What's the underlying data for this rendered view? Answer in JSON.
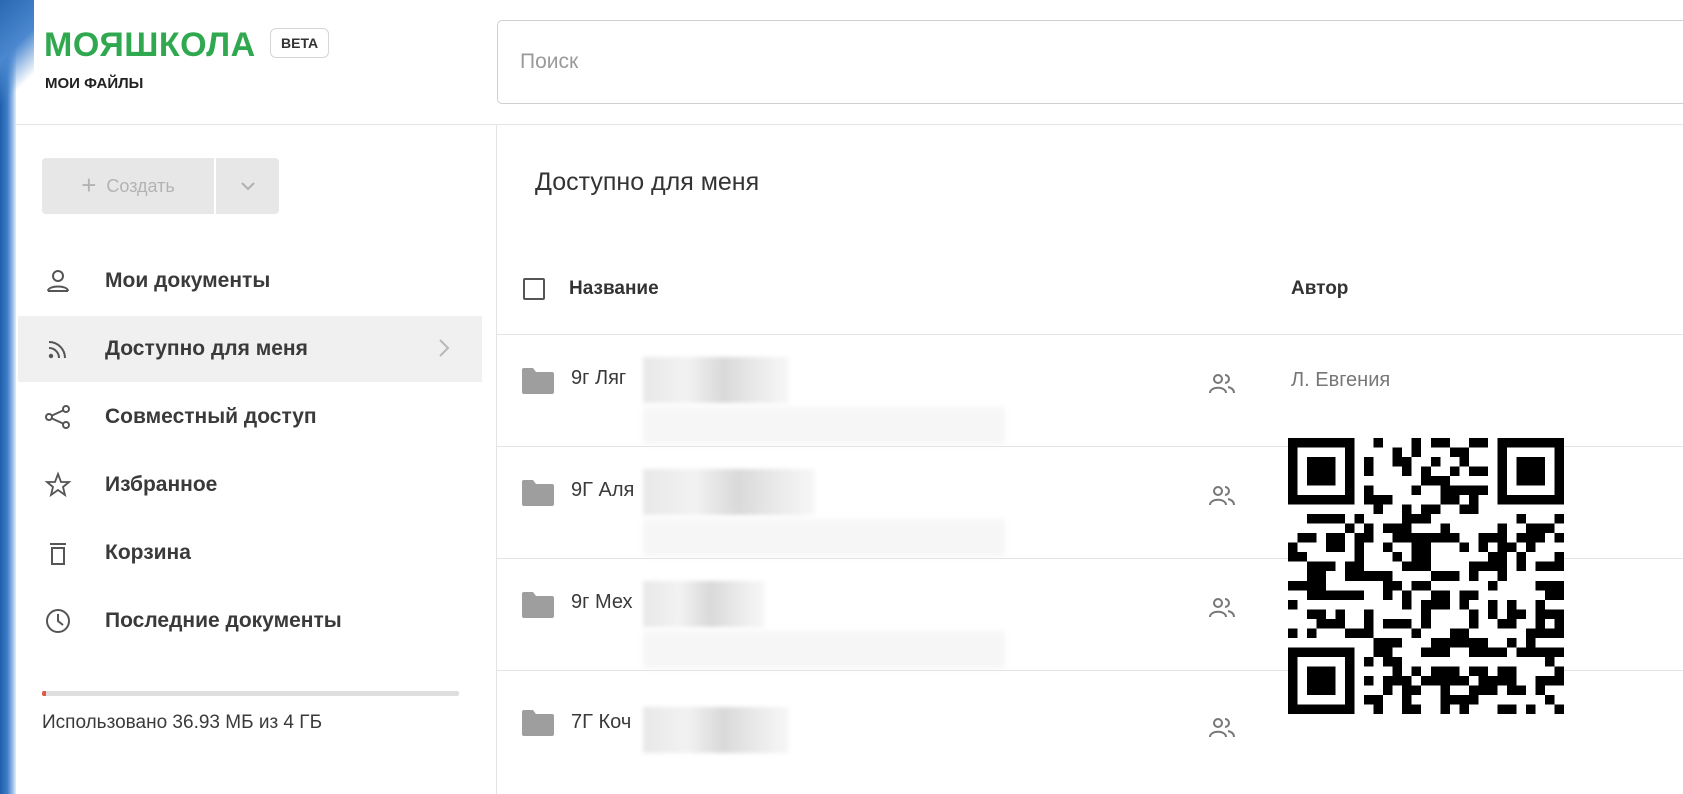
{
  "header": {
    "logo": "МОЯШКОЛА",
    "badge": "BETA",
    "subtitle": "МОИ ФАЙЛЫ",
    "search_placeholder": "Поиск"
  },
  "sidebar": {
    "create_label": "Создать",
    "items": [
      {
        "label": "Мои документы",
        "icon": "person-icon"
      },
      {
        "label": "Доступно для меня",
        "icon": "rss-icon",
        "active": true
      },
      {
        "label": "Совместный доступ",
        "icon": "share-icon"
      },
      {
        "label": "Избранное",
        "icon": "star-icon"
      },
      {
        "label": "Корзина",
        "icon": "trash-icon"
      },
      {
        "label": "Последние документы",
        "icon": "clock-icon"
      }
    ],
    "storage_text": "Использовано 36.93 МБ из 4 ГБ",
    "storage_used_fraction": 0.009
  },
  "main": {
    "title": "Доступно для меня",
    "columns": {
      "name": "Название",
      "author": "Автор"
    },
    "rows": [
      {
        "name": "9г Ляг",
        "author": "Л. Евгения"
      },
      {
        "name": "9Г Аля",
        "author": ""
      },
      {
        "name": "9г Мех",
        "author": ""
      },
      {
        "name": "7Г Коч",
        "author": ""
      }
    ]
  },
  "colors": {
    "brand": "#2fa84f",
    "active_bg": "#f0f0f0",
    "storage_fill": "#e05a4a"
  }
}
